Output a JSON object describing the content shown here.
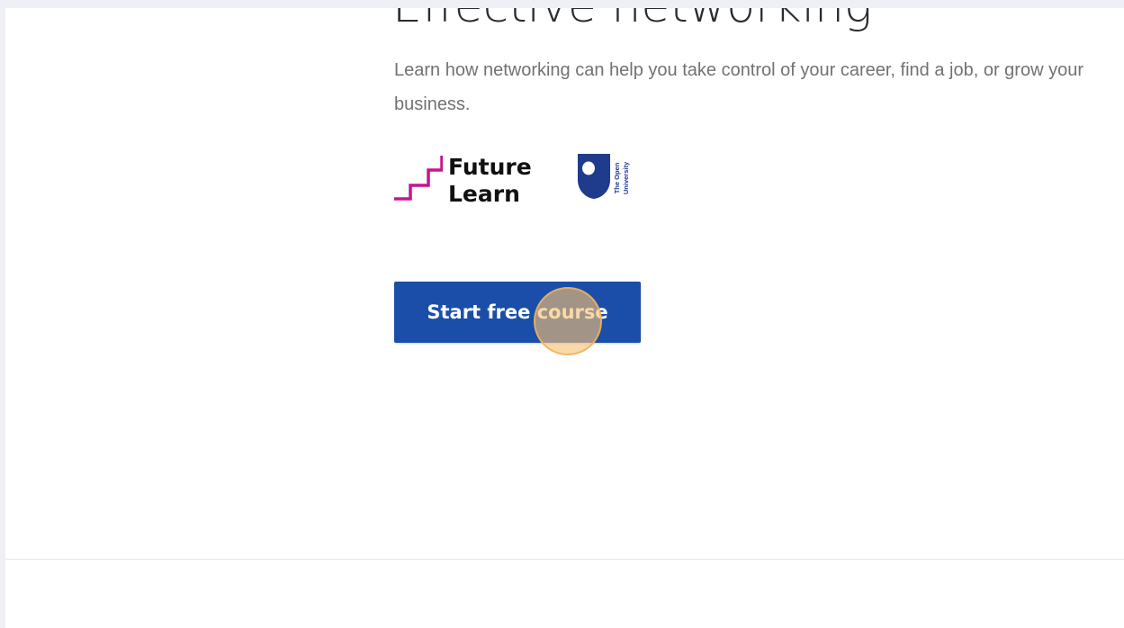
{
  "course": {
    "title": "Effective networking",
    "description": "Learn how networking can help you take control of your career, find a job, or grow your business."
  },
  "partners": {
    "futurelearn": {
      "line1": "Future",
      "line2": "Learn",
      "icon": "futurelearn-staircase-icon",
      "color": "#c4168e"
    },
    "open_university": {
      "line1": "The Open",
      "line2": "University",
      "icon": "open-university-shield-icon",
      "color": "#1e3b8c"
    }
  },
  "cta": {
    "label": "Start free course",
    "color": "#1a4ea8"
  }
}
